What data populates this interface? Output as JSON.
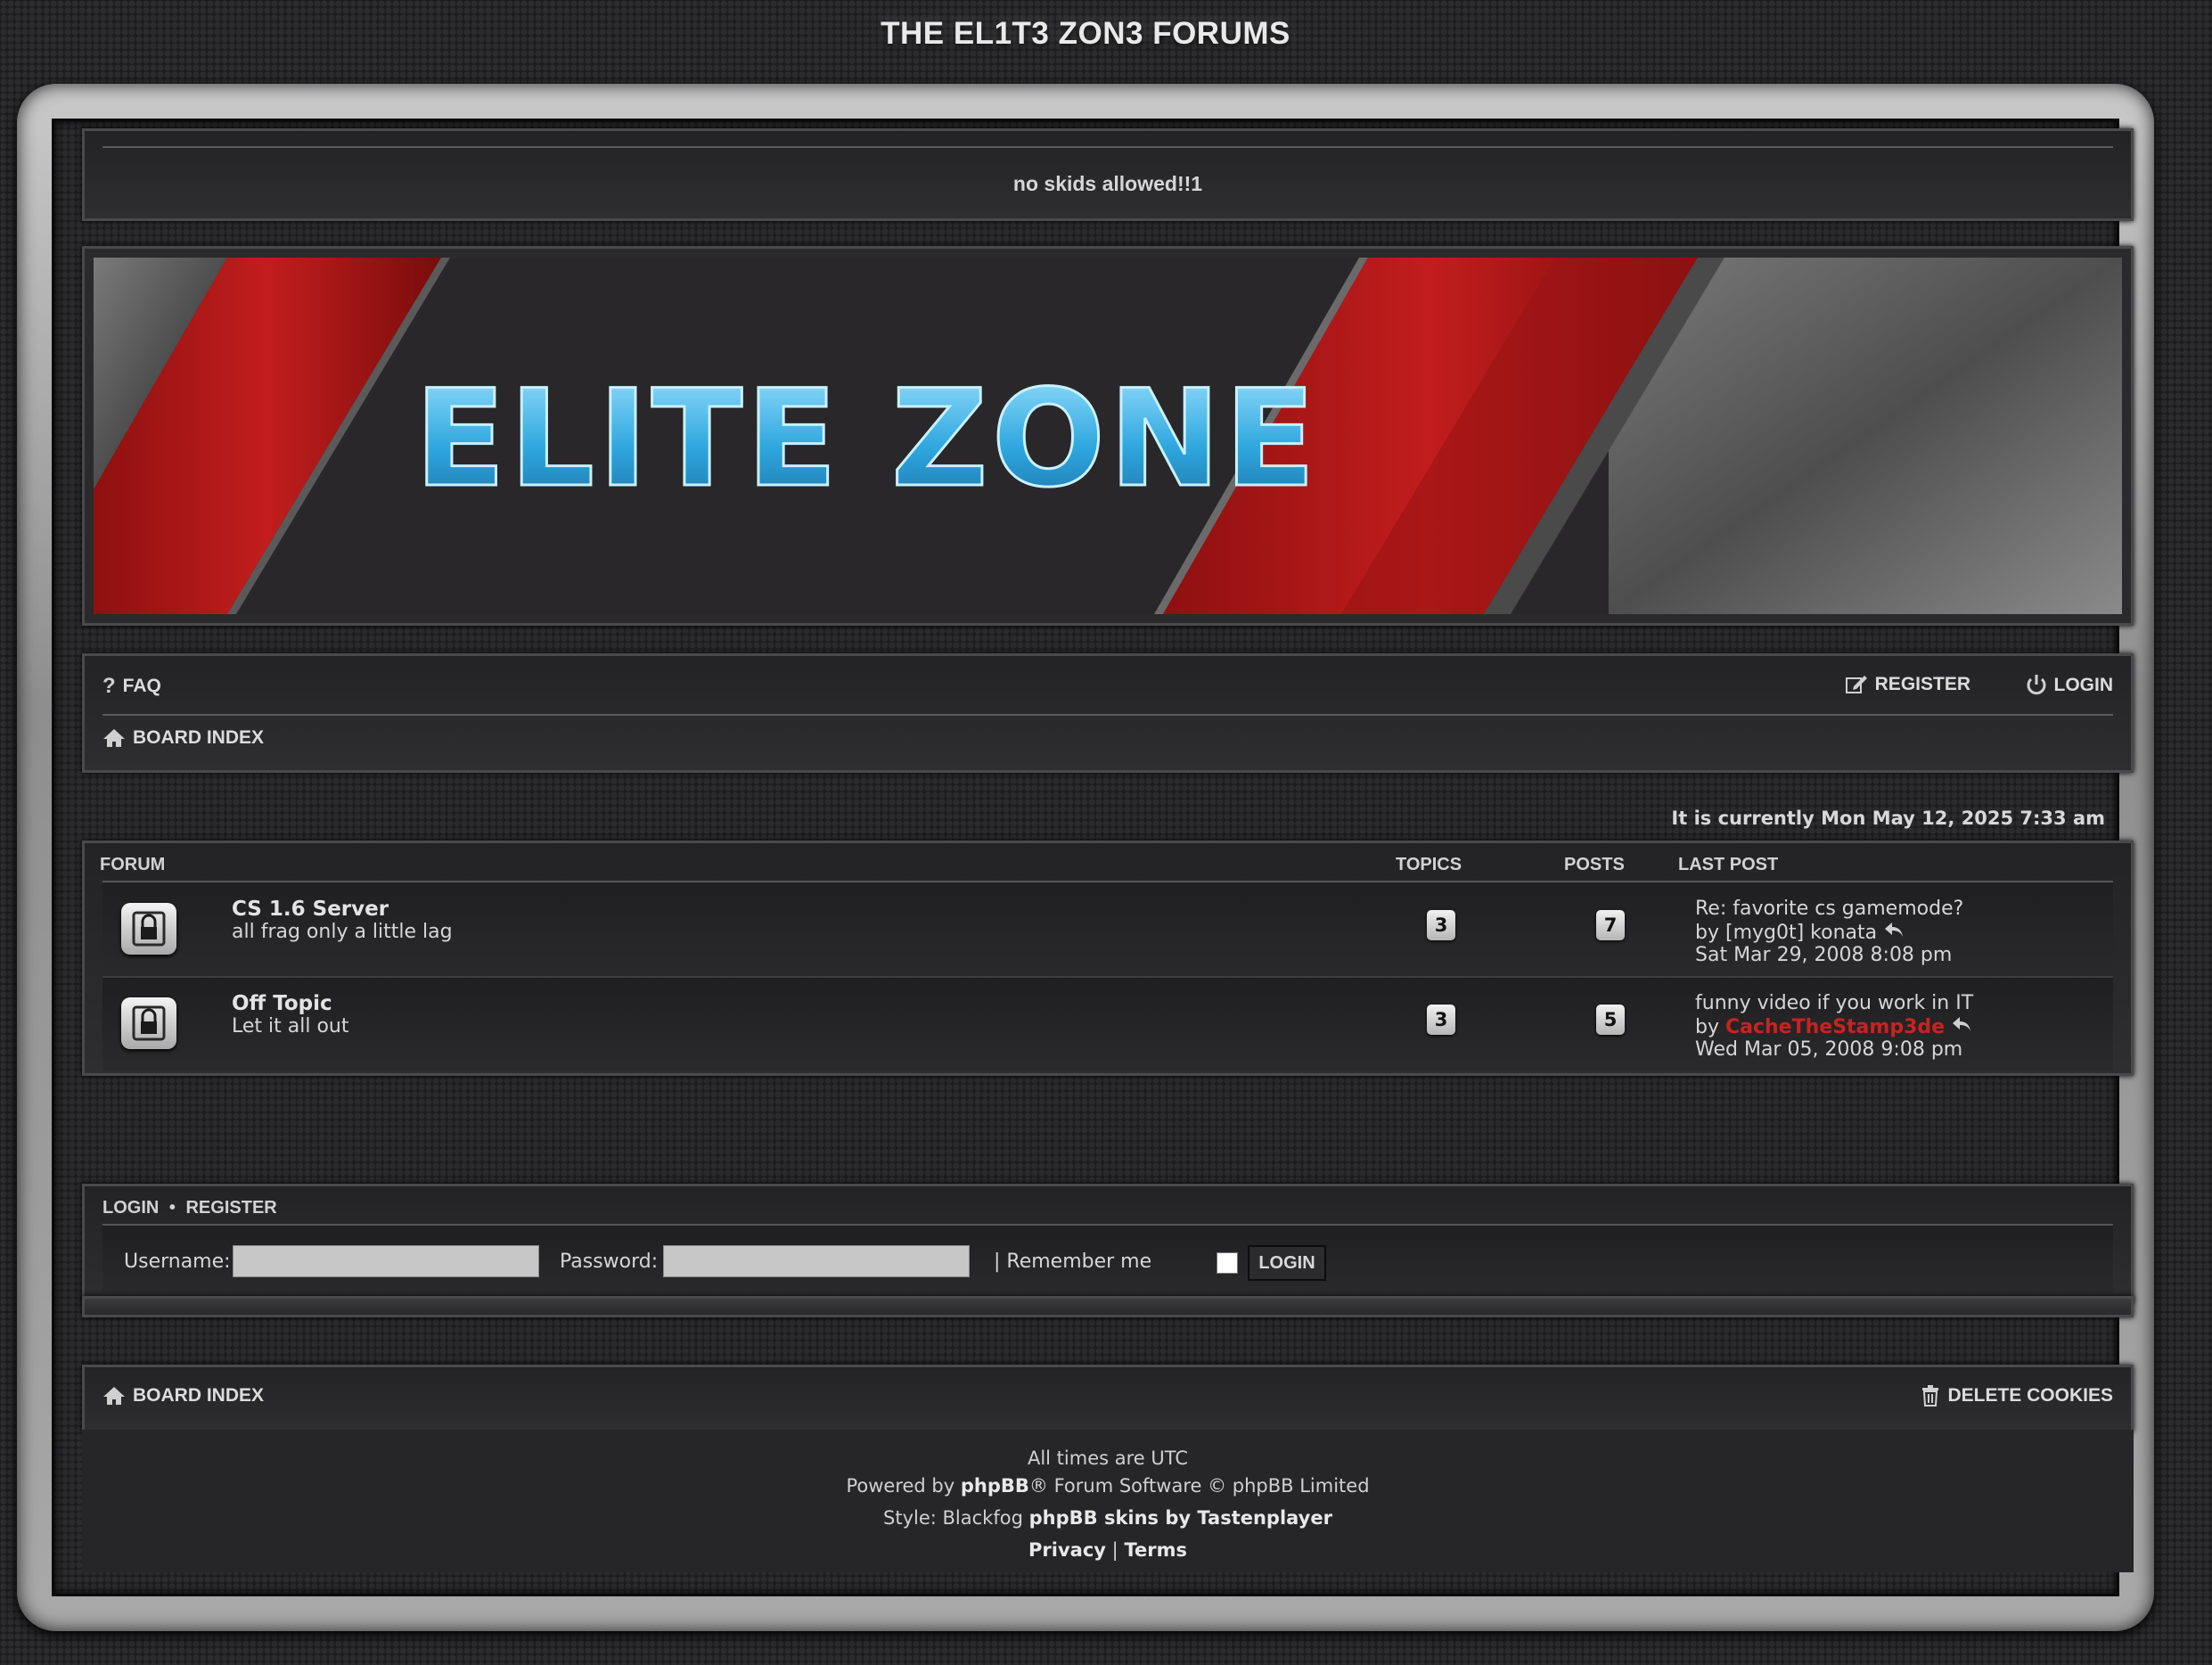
{
  "site_title": "THE EL1T3 ZON3 FORUMS",
  "site_description": "no skids allowed!!1",
  "banner": {
    "logo_text": "ELITE ZONE"
  },
  "nav": {
    "faq": "FAQ",
    "register": "REGISTER",
    "login": "LOGIN",
    "board_index": "BOARD INDEX"
  },
  "current_time": "It is currently Mon May 12, 2025 7:33 am",
  "forum_table": {
    "headers": {
      "forum": "FORUM",
      "topics": "TOPICS",
      "posts": "POSTS",
      "last_post": "LAST POST"
    },
    "rows": [
      {
        "title": "CS 1.6 Server",
        "description": "all frag only a little lag",
        "topics": "3",
        "posts": "7",
        "last_post_title": "Re: favorite cs gamemode?",
        "last_post_by_prefix": "by",
        "last_post_user": "[myg0t] konata",
        "last_post_date": "Sat Mar 29, 2008 8:08 pm"
      },
      {
        "title": "Off Topic",
        "description": "Let it all out",
        "topics": "3",
        "posts": "5",
        "last_post_title": "funny video if you work in IT",
        "last_post_by_prefix": "by",
        "last_post_user": "CacheTheStamp3de",
        "last_post_date": "Wed Mar 05, 2008 9:08 pm"
      }
    ]
  },
  "login_box": {
    "login_link": "LOGIN",
    "separator": "•",
    "register_link": "REGISTER",
    "username_label": "Username:",
    "password_label": "Password:",
    "remember_label": "| Remember me",
    "login_button": "LOGIN"
  },
  "bottom_nav": {
    "board_index": "BOARD INDEX",
    "delete_cookies": "DELETE COOKIES"
  },
  "footer": {
    "timezone": "All times are UTC",
    "powered_prefix": "Powered by",
    "phpbb": "phpBB",
    "powered_suffix": "® Forum Software © phpBB Limited",
    "style_prefix": "Style: Blackfog",
    "style_link": "phpBB skins by Tastenplayer",
    "privacy": "Privacy",
    "pipe": "|",
    "terms": "Terms"
  },
  "colors": {
    "user_red": "#c8231f",
    "banner_red": "#b11a1a",
    "logo_blue": "#3ab4e8"
  }
}
